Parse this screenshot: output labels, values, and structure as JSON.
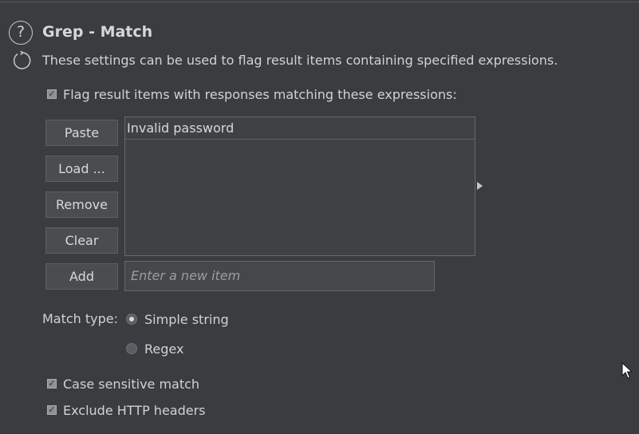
{
  "section": {
    "help_glyph": "?",
    "title": "Grep - Match",
    "description": "These settings can be used to flag result items containing specified expressions."
  },
  "flag_option": {
    "label": "Flag result items with responses matching these expressions:",
    "checked": true
  },
  "buttons": {
    "paste": "Paste",
    "load": "Load ...",
    "remove": "Remove",
    "clear": "Clear",
    "add": "Add"
  },
  "expressions": [
    "Invalid password"
  ],
  "new_item_input": {
    "value": "",
    "placeholder": "Enter a new item"
  },
  "match_type": {
    "label": "Match type:",
    "options": [
      {
        "label": "Simple string",
        "selected": true
      },
      {
        "label": "Regex",
        "selected": false
      }
    ]
  },
  "options": {
    "case_sensitive": {
      "label": "Case sensitive match",
      "checked": true
    },
    "exclude_headers": {
      "label": "Exclude HTTP headers",
      "checked": true
    }
  },
  "icons": {
    "help": "help-icon",
    "refresh": "refresh-icon",
    "checkmark": "checkmark-icon",
    "collapse": "collapse-arrow-icon",
    "cursor": "mouse-cursor-icon"
  },
  "colors": {
    "background": "#3a3c3f",
    "text": "#d2d2d2",
    "button": "#4a4d50",
    "field_border": "#65686c"
  }
}
